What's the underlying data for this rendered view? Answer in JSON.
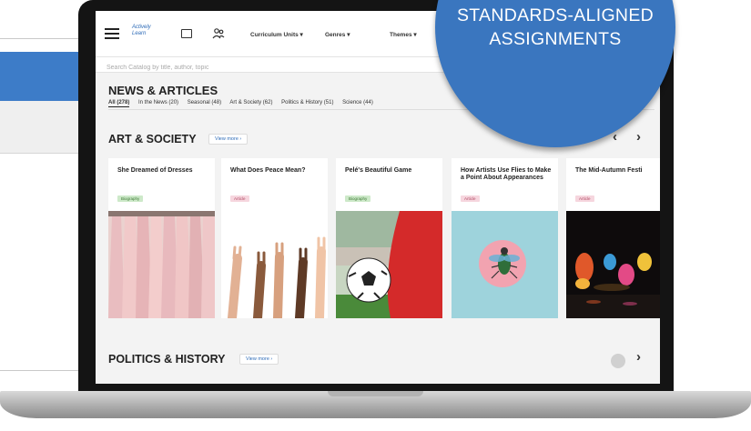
{
  "badge": {
    "line1": "STANDARDS-ALIGNED",
    "line2": "ASSIGNMENTS"
  },
  "header": {
    "logo": "Actively Learn",
    "nav": [
      "Curriculum Units ▾",
      "Genres ▾",
      "Themes ▾"
    ]
  },
  "search": {
    "placeholder": "Search Catalog by title, author, topic"
  },
  "news": {
    "title": "NEWS & ARTICLES",
    "tabs": [
      "All (278)",
      "In the News (20)",
      "Seasonal (48)",
      "Art & Society (62)",
      "Politics & History (51)",
      "Science (44)"
    ]
  },
  "art_section": {
    "title": "ART & SOCIETY",
    "view_more": "View more ›",
    "cards": [
      {
        "title": "She Dreamed of Dresses",
        "tag": "Biography",
        "image": "dresses-on-rack"
      },
      {
        "title": "What Does Peace Mean?",
        "tag": "Article",
        "image": "peace-sign-hands"
      },
      {
        "title": "Pelé's Beautiful Game",
        "tag": "Biography",
        "image": "soccer-player-with-ball"
      },
      {
        "title": "How Artists Use Flies to Make a Point About Appearances",
        "tag": "Article",
        "image": "fly-on-pink-circle"
      },
      {
        "title": "The Mid-Autumn Festi",
        "tag": "Article",
        "image": "lantern-festival-night"
      }
    ]
  },
  "politics_section": {
    "title": "POLITICS & HISTORY",
    "view_more": "View more ›"
  },
  "colors": {
    "badge": "#3a76bf",
    "brand_link": "#2c6ab7",
    "biography_tag": "#cde9c9",
    "article_tag": "#f6d6de"
  }
}
